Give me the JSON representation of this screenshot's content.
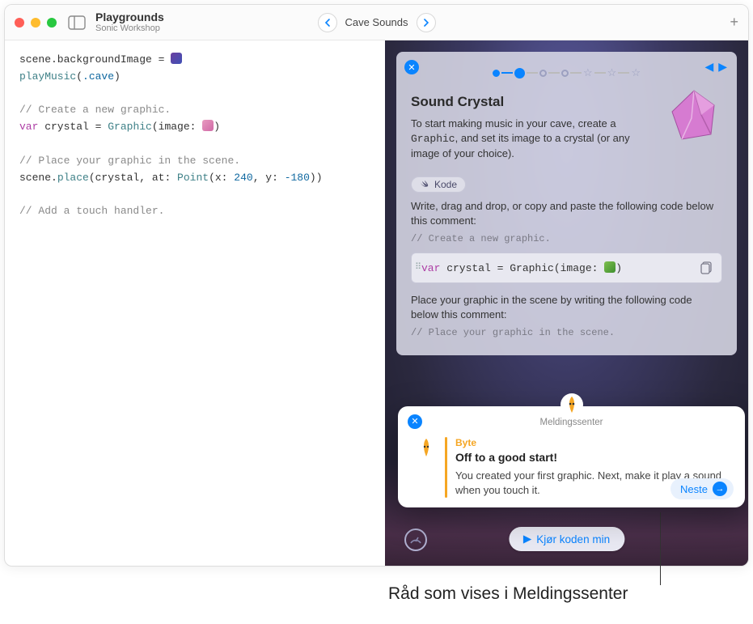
{
  "header": {
    "title": "Playgrounds",
    "subtitle": "Sonic Workshop",
    "navTitle": "Cave Sounds"
  },
  "code": {
    "l1a": "scene.backgroundImage = ",
    "l2a": "playMusic",
    "l2b": "(",
    "l2c": ".cave",
    "l2d": ")",
    "c1": "// Create a new graphic.",
    "l3a": "var",
    "l3b": " crystal = ",
    "l3c": "Graphic",
    "l3d": "(image: ",
    "l3e": ")",
    "c2": "// Place your graphic in the scene.",
    "l4a": "scene.",
    "l4b": "place",
    "l4c": "(crystal, at: ",
    "l4d": "Point",
    "l4e": "(x: ",
    "l4f": "240",
    "l4g": ", y: ",
    "l4h": "-180",
    "l4i": "))",
    "c3": "// Add a touch handler."
  },
  "panel": {
    "title": "Sound Crystal",
    "text1a": "To start making music in your cave, create a ",
    "text1code": "Graphic",
    "text1b": ", and set its image to a crystal (or any image of your choice).",
    "badge": "Kode",
    "sub1": "Write, drag and drop, or copy and paste the following code below this comment:",
    "sub1c": "// Create a new graphic.",
    "codeblock_a": "var",
    "codeblock_b": " crystal = Graphic(image: ",
    "codeblock_c": ")",
    "sub2": "Place your graphic in the scene by writing the following code below this comment:",
    "sub2c": "// Place your graphic in the scene."
  },
  "msg": {
    "center": "Meldingssenter",
    "label": "Byte",
    "heading": "Off to a good start!",
    "body": "You created your first graphic. Next, make it play a sound when you touch it.",
    "next": "Neste"
  },
  "run": {
    "label": "Kjør koden min"
  },
  "caption": "Råd som vises i Meldingssenter"
}
